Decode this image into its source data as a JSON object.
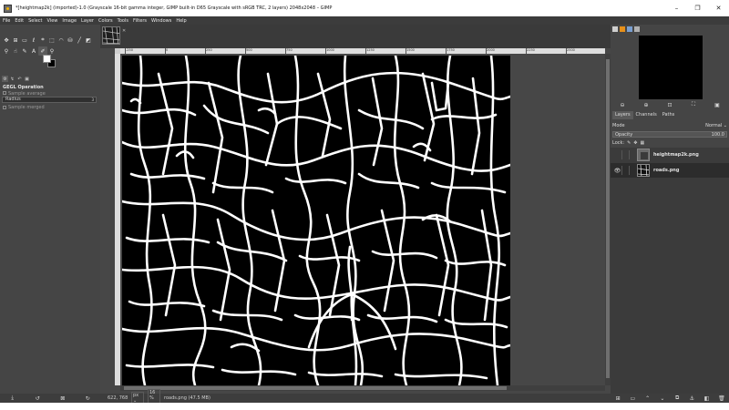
{
  "window": {
    "title": "*[heightmap2k] (imported)-1.0 (Grayscale 16-bit gamma integer, GIMP built-in D65 Grayscale with sRGB TRC, 2 layers) 2048x2048 – GIMP",
    "minimize": "–",
    "maximize": "❐",
    "close": "✕"
  },
  "menu": [
    "File",
    "Edit",
    "Select",
    "View",
    "Image",
    "Layer",
    "Colors",
    "Tools",
    "Filters",
    "Windows",
    "Help"
  ],
  "tool_options": {
    "header": "GEGL Operation",
    "sample_average": "Sample average",
    "radius_label": "Radius",
    "radius_value": "3",
    "sample_merged": "Sample merged"
  },
  "image_tab": {
    "close": "✕"
  },
  "ruler": {
    "ticks": [
      "-250",
      "0",
      "250",
      "500",
      "750",
      "1000",
      "1250",
      "1500",
      "1750",
      "2000",
      "2250",
      "2500"
    ]
  },
  "status": {
    "coords": "622, 768",
    "unit": "px ⌄",
    "zoom": "16 % ⌄",
    "info": "roads.png (47.5 MB)"
  },
  "layers_panel": {
    "tabs": [
      "Layers",
      "Channels",
      "Paths"
    ],
    "mode_label": "Mode",
    "mode_value": "Normal ⌄",
    "opacity_label": "Opacity",
    "opacity_value": "100.0",
    "lock_label": "Lock:",
    "layers": [
      {
        "name": "heightmap2k.png",
        "visible": false
      },
      {
        "name": "roads.png",
        "visible": true
      }
    ]
  },
  "icons": {
    "eye": "👁",
    "move": "✥",
    "text": "A"
  },
  "colors": {
    "foreground": "#ffffff",
    "background": "#000000",
    "canvas_bg": "#000000",
    "road": "#ffffff"
  }
}
